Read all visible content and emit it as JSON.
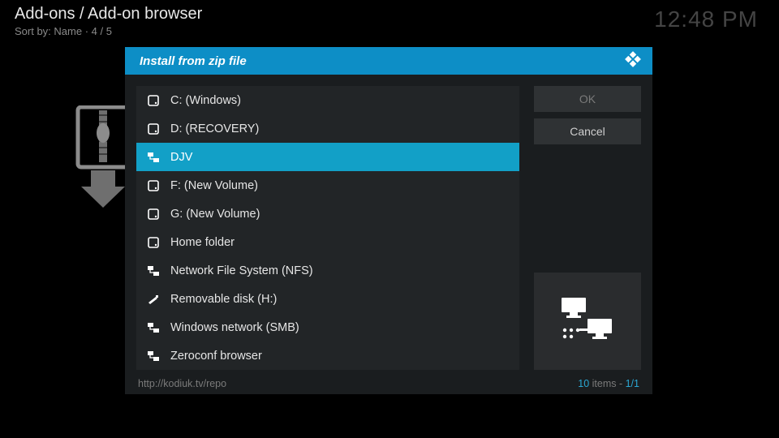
{
  "header": {
    "breadcrumb": "Add-ons / Add-on browser",
    "sort_prefix": "Sort by: ",
    "sort_value": "Name",
    "sort_sep": "  ·  ",
    "sort_pos": "4 / 5"
  },
  "clock": "12:48 PM",
  "dialog": {
    "title": "Install from zip file",
    "ok_label": "OK",
    "cancel_label": "Cancel",
    "items": [
      {
        "icon": "hdd-icon",
        "label": "C: (Windows)"
      },
      {
        "icon": "hdd-icon",
        "label": "D: (RECOVERY)"
      },
      {
        "icon": "net-icon",
        "label": "DJV",
        "selected": true
      },
      {
        "icon": "hdd-icon",
        "label": "F: (New Volume)"
      },
      {
        "icon": "hdd-icon",
        "label": "G: (New Volume)"
      },
      {
        "icon": "hdd-icon",
        "label": "Home folder"
      },
      {
        "icon": "net-icon",
        "label": "Network File System (NFS)"
      },
      {
        "icon": "usb-icon",
        "label": "Removable disk (H:)"
      },
      {
        "icon": "net-icon",
        "label": "Windows network (SMB)"
      },
      {
        "icon": "net-icon",
        "label": "Zeroconf browser"
      }
    ],
    "status_left": "http://kodiuk.tv/repo",
    "status_count": "10",
    "status_items_word": " items",
    "status_sep": " - ",
    "status_page": "1/1"
  }
}
